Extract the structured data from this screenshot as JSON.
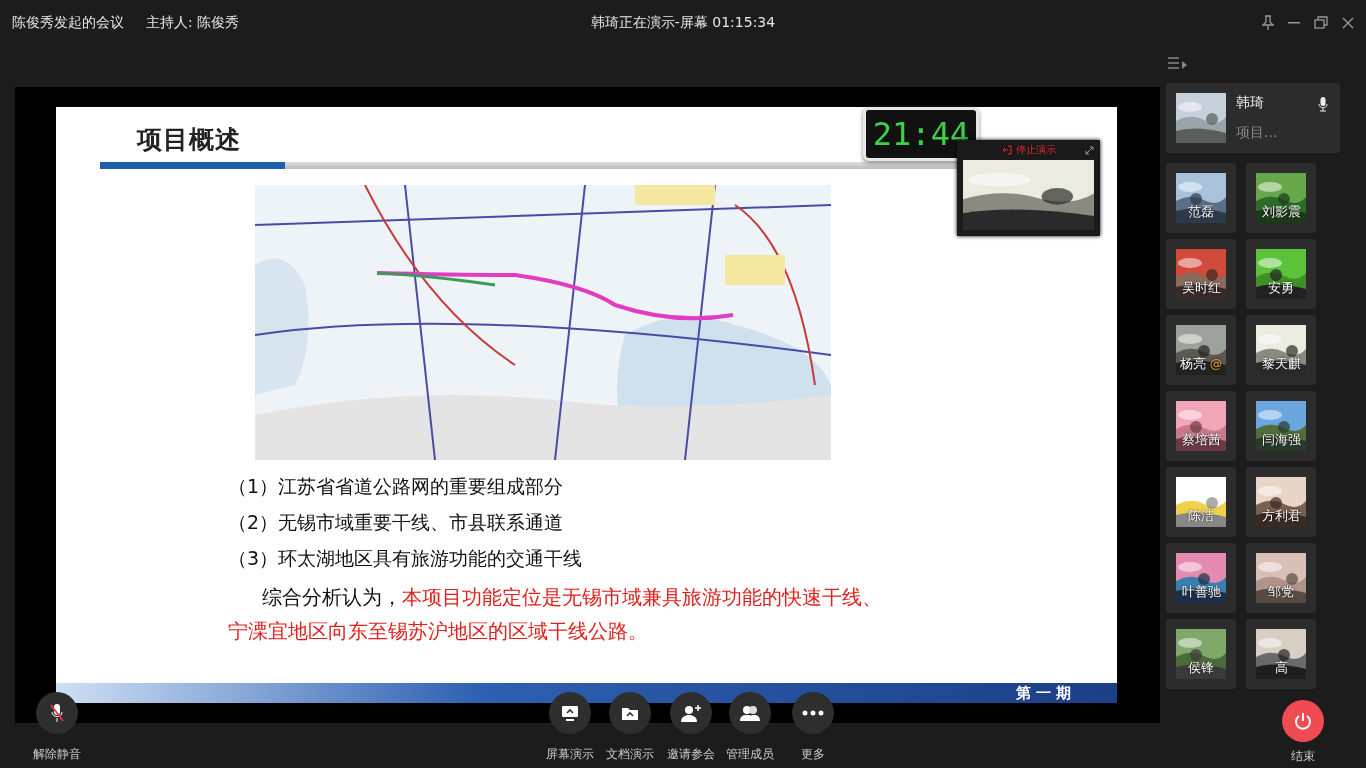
{
  "meeting": {
    "title": "陈俊秀发起的会议",
    "host": "主持人: 陈俊秀",
    "status": "韩琦正在演示-屏幕 01:15:34"
  },
  "slide": {
    "title": "项目概述",
    "points": [
      "（1）江苏省省道公路网的重要组成部分",
      "（2）无锡市域重要干线、市县联系通道",
      "（3）环太湖地区具有旅游功能的交通干线"
    ],
    "summary": {
      "lead": "综合分析认为，",
      "highlight": "本项目功能定位是无锡市域兼具旅游功能的快速干线、宁溧宜地区向东至锡苏沪地区的区域干线公路。"
    },
    "footer": "第 一 期"
  },
  "clock": {
    "time": "21:44"
  },
  "preview": {
    "label": "停止演示"
  },
  "presenter": {
    "name": "韩琦",
    "subtitle": "项目...",
    "speaking": true
  },
  "participants": [
    {
      "name": "范磊"
    },
    {
      "name": "刘影震"
    },
    {
      "name": "吴时红"
    },
    {
      "name": "安勇"
    },
    {
      "name": "杨亮",
      "badge": "@"
    },
    {
      "name": "黎天麒"
    },
    {
      "name": "蔡培茜"
    },
    {
      "name": "闫海强"
    },
    {
      "name": "陈洁"
    },
    {
      "name": "方利君"
    },
    {
      "name": "叶善驰"
    },
    {
      "name": "邹党"
    },
    {
      "name": "侯锋"
    },
    {
      "name": "高"
    }
  ],
  "mic": {
    "label": "解除静音",
    "muted": true
  },
  "toolbar": [
    {
      "label": "屏幕演示",
      "kind": "screen"
    },
    {
      "label": "文档演示",
      "kind": "document"
    },
    {
      "label": "邀请参会",
      "kind": "invite"
    },
    {
      "label": "管理成员",
      "kind": "members"
    },
    {
      "label": "更多",
      "kind": "more"
    }
  ],
  "end": {
    "label": "结束"
  }
}
